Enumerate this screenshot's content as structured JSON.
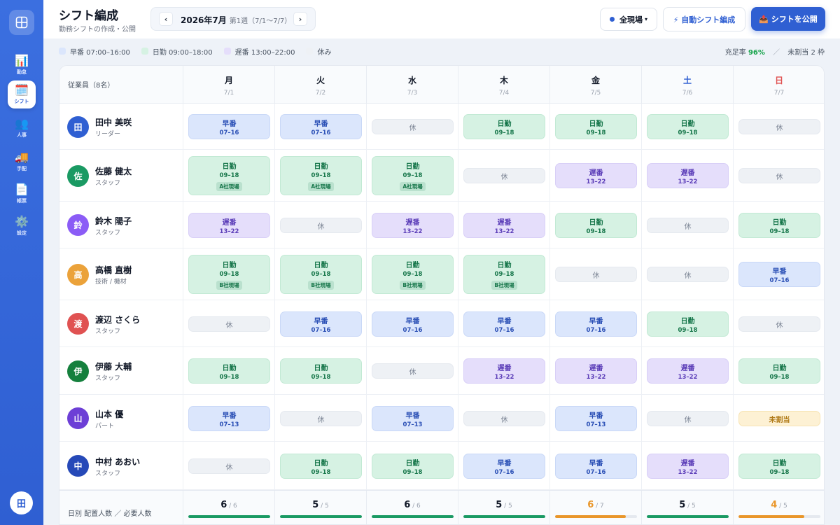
{
  "header": {
    "title": "シフト編成",
    "subtitle": "勤務シフトの作成・公開",
    "week_main": "2026年7月",
    "week_sub": "第1週（7/1〜7/7）",
    "prev_icon": "‹",
    "next_icon": "›",
    "site_label": "全現場",
    "auto_label": "⚡ 自動シフト編成",
    "publish_label": "📤 シフトを公開"
  },
  "sidebar": {
    "items": [
      {
        "icon": "📊",
        "label": "勤怠"
      },
      {
        "icon": "🗓️",
        "label": "シフト"
      },
      {
        "icon": "👥",
        "label": "人事"
      },
      {
        "icon": "🚚",
        "label": "手配"
      },
      {
        "icon": "📄",
        "label": "帳票"
      },
      {
        "icon": "⚙️",
        "label": "設定"
      }
    ],
    "active_index": 1,
    "bottom_label": "田"
  },
  "legend": {
    "items": [
      {
        "label": "早番 07:00–16:00",
        "color": "#dbe6fc"
      },
      {
        "label": "日勤 09:00–18:00",
        "color": "#d6f2e3"
      },
      {
        "label": "遅番 13:00–22:00",
        "color": "#e5defb"
      },
      {
        "label": "休み",
        "color": "#eef1f5"
      }
    ],
    "rate_label": "充足率",
    "rate_value": "96%",
    "unassigned_text": "未割当 2 枠"
  },
  "grid": {
    "employee_header": "従業員（8名）",
    "days": [
      {
        "name": "月",
        "date": "7/1",
        "kind": "weekday"
      },
      {
        "name": "火",
        "date": "7/2",
        "kind": "weekday"
      },
      {
        "name": "水",
        "date": "7/3",
        "kind": "weekday"
      },
      {
        "name": "木",
        "date": "7/4",
        "kind": "weekday"
      },
      {
        "name": "金",
        "date": "7/5",
        "kind": "weekday"
      },
      {
        "name": "土",
        "date": "7/6",
        "kind": "sat"
      },
      {
        "name": "日",
        "date": "7/7",
        "kind": "sun"
      }
    ],
    "employees": [
      {
        "initial": "田",
        "name": "田中 美咲",
        "role": "リーダー",
        "color": "#2f5fd2",
        "shifts": [
          {
            "type": "early",
            "label": "早番",
            "time": "07–16"
          },
          {
            "type": "early",
            "label": "早番",
            "time": "07–16"
          },
          {
            "type": "off",
            "label": "休"
          },
          {
            "type": "day",
            "label": "日勤",
            "time": "09–18"
          },
          {
            "type": "day",
            "label": "日勤",
            "time": "09–18"
          },
          {
            "type": "day",
            "label": "日勤",
            "time": "09–18"
          },
          {
            "type": "off",
            "label": "休"
          }
        ]
      },
      {
        "initial": "佐",
        "name": "佐藤 健太",
        "role": "スタッフ",
        "color": "#1a9a63",
        "shifts": [
          {
            "type": "day",
            "label": "日勤",
            "time": "09–18",
            "site": "A社現場"
          },
          {
            "type": "day",
            "label": "日勤",
            "time": "09–18",
            "site": "A社現場"
          },
          {
            "type": "day",
            "label": "日勤",
            "time": "09–18",
            "site": "A社現場"
          },
          {
            "type": "off",
            "label": "休"
          },
          {
            "type": "late",
            "label": "遅番",
            "time": "13–22"
          },
          {
            "type": "late",
            "label": "遅番",
            "time": "13–22"
          },
          {
            "type": "off",
            "label": "休"
          }
        ]
      },
      {
        "initial": "鈴",
        "name": "鈴木 陽子",
        "role": "スタッフ",
        "color": "#8b5cf6",
        "shifts": [
          {
            "type": "late",
            "label": "遅番",
            "time": "13–22"
          },
          {
            "type": "off",
            "label": "休"
          },
          {
            "type": "late",
            "label": "遅番",
            "time": "13–22"
          },
          {
            "type": "late",
            "label": "遅番",
            "time": "13–22"
          },
          {
            "type": "day",
            "label": "日勤",
            "time": "09–18"
          },
          {
            "type": "off",
            "label": "休"
          },
          {
            "type": "day",
            "label": "日勤",
            "time": "09–18"
          }
        ]
      },
      {
        "initial": "高",
        "name": "高橋 直樹",
        "role": "技術 / 機材",
        "color": "#eba23a",
        "shifts": [
          {
            "type": "day",
            "label": "日勤",
            "time": "09–18",
            "site": "B社現場"
          },
          {
            "type": "day",
            "label": "日勤",
            "time": "09–18",
            "site": "B社現場"
          },
          {
            "type": "day",
            "label": "日勤",
            "time": "09–18",
            "site": "B社現場"
          },
          {
            "type": "day",
            "label": "日勤",
            "time": "09–18",
            "site": "B社現場"
          },
          {
            "type": "off",
            "label": "休"
          },
          {
            "type": "off",
            "label": "休"
          },
          {
            "type": "early",
            "label": "早番",
            "time": "07–16"
          }
        ]
      },
      {
        "initial": "渡",
        "name": "渡辺 さくら",
        "role": "スタッフ",
        "color": "#e05252",
        "shifts": [
          {
            "type": "off",
            "label": "休"
          },
          {
            "type": "early",
            "label": "早番",
            "time": "07–16"
          },
          {
            "type": "early",
            "label": "早番",
            "time": "07–16"
          },
          {
            "type": "early",
            "label": "早番",
            "time": "07–16"
          },
          {
            "type": "early",
            "label": "早番",
            "time": "07–16"
          },
          {
            "type": "day",
            "label": "日勤",
            "time": "09–18"
          },
          {
            "type": "off",
            "label": "休"
          }
        ]
      },
      {
        "initial": "伊",
        "name": "伊藤 大輔",
        "role": "スタッフ",
        "color": "#15803d",
        "shifts": [
          {
            "type": "day",
            "label": "日勤",
            "time": "09–18"
          },
          {
            "type": "day",
            "label": "日勤",
            "time": "09–18"
          },
          {
            "type": "off",
            "label": "休"
          },
          {
            "type": "late",
            "label": "遅番",
            "time": "13–22"
          },
          {
            "type": "late",
            "label": "遅番",
            "time": "13–22"
          },
          {
            "type": "late",
            "label": "遅番",
            "time": "13–22"
          },
          {
            "type": "day",
            "label": "日勤",
            "time": "09–18"
          }
        ]
      },
      {
        "initial": "山",
        "name": "山本 優",
        "role": "パート",
        "color": "#6d3fd6",
        "shifts": [
          {
            "type": "early",
            "label": "早番",
            "time": "07–13"
          },
          {
            "type": "off",
            "label": "休"
          },
          {
            "type": "early",
            "label": "早番",
            "time": "07–13"
          },
          {
            "type": "off",
            "label": "休"
          },
          {
            "type": "early",
            "label": "早番",
            "time": "07–13"
          },
          {
            "type": "off",
            "label": "休"
          },
          {
            "type": "unassigned",
            "label": "未割当"
          }
        ]
      },
      {
        "initial": "中",
        "name": "中村 あおい",
        "role": "スタッフ",
        "color": "#2649b8",
        "shifts": [
          {
            "type": "off",
            "label": "休"
          },
          {
            "type": "day",
            "label": "日勤",
            "time": "09–18"
          },
          {
            "type": "day",
            "label": "日勤",
            "time": "09–18"
          },
          {
            "type": "early",
            "label": "早番",
            "time": "07–16"
          },
          {
            "type": "early",
            "label": "早番",
            "time": "07–16"
          },
          {
            "type": "late",
            "label": "遅番",
            "time": "13–22"
          },
          {
            "type": "day",
            "label": "日勤",
            "time": "09–18"
          }
        ]
      }
    ],
    "footer_label": "日別 配置人数 ／ 必要人数",
    "totals": [
      {
        "placed": "6",
        "required": "6",
        "fill": 1.0
      },
      {
        "placed": "5",
        "required": "5",
        "fill": 1.0
      },
      {
        "placed": "6",
        "required": "6",
        "fill": 1.0
      },
      {
        "placed": "5",
        "required": "5",
        "fill": 1.0
      },
      {
        "placed": "6",
        "required": "7",
        "fill": 0.86
      },
      {
        "placed": "5",
        "required": "5",
        "fill": 1.0
      },
      {
        "placed": "4",
        "required": "5",
        "fill": 0.8
      }
    ]
  },
  "colors": {
    "accent": "#2f5fd2",
    "ok": "#1a9a63",
    "warn": "#e9962a"
  }
}
